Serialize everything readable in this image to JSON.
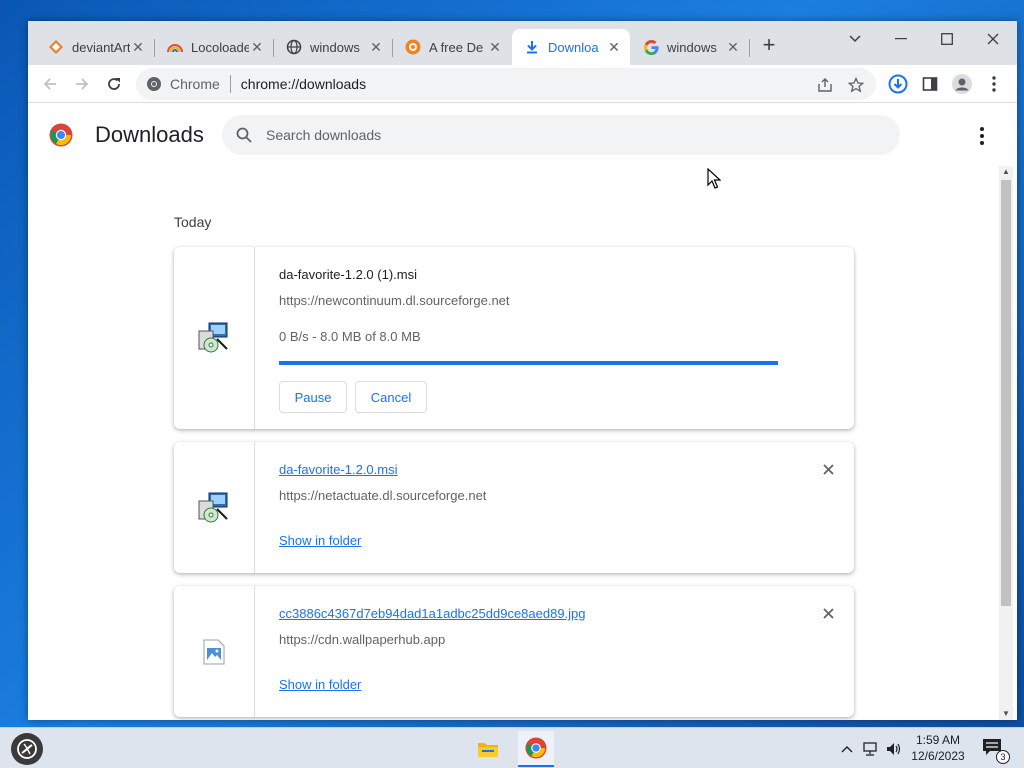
{
  "browser": {
    "tabs": [
      {
        "title": "deviantArt",
        "favicon": "deviantart-icon"
      },
      {
        "title": "Locoloader",
        "favicon": "locoloader-icon"
      },
      {
        "title": "windows",
        "favicon": "globe-icon"
      },
      {
        "title": "A free De",
        "favicon": "sourceforge-icon"
      },
      {
        "title": "Downloa",
        "favicon": "download-icon",
        "active": true
      },
      {
        "title": "windows",
        "favicon": "google-icon"
      }
    ],
    "address_chip": "Chrome",
    "address_url": "chrome://downloads"
  },
  "downloads_page": {
    "title": "Downloads",
    "search_placeholder": "Search downloads",
    "section_label": "Today",
    "items": [
      {
        "filename": "da-favorite-1.2.0 (1).msi",
        "source": "https://newcontinuum.dl.sourceforge.net",
        "status": "0 B/s - 8.0 MB of 8.0 MB",
        "progress_percent": 100,
        "buttons": [
          "Pause",
          "Cancel"
        ],
        "icon": "installer-icon"
      },
      {
        "filename": "da-favorite-1.2.0.msi",
        "source": "https://netactuate.dl.sourceforge.net",
        "action_link": "Show in folder",
        "icon": "installer-icon"
      },
      {
        "filename": "cc3886c4367d7eb94dad1a1adbc25dd9ce8aed89.jpg",
        "source": "https://cdn.wallpaperhub.app",
        "action_link": "Show in folder",
        "icon": "image-file-icon"
      }
    ]
  },
  "taskbar": {
    "time": "1:59 AM",
    "date": "12/6/2023",
    "notification_count": "3"
  },
  "colors": {
    "accent": "#1a73e8",
    "tabstrip": "#dee1e6",
    "desktop": "#1b7fe0"
  }
}
